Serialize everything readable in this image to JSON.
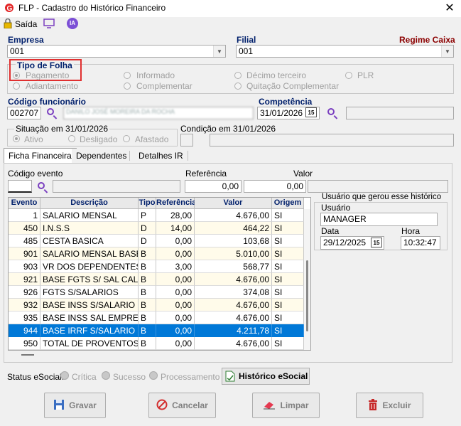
{
  "window": {
    "title": "FLP - Cadastro do Histórico Financeiro",
    "close_label": "✕"
  },
  "toolbar": {
    "saida_label": "Saída",
    "ia_label": "IA"
  },
  "empresa": {
    "label": "Empresa",
    "value": "001"
  },
  "filial": {
    "label": "Filial",
    "value": "001"
  },
  "regime_label": "Regime Caixa",
  "tipo_folha": {
    "label": "Tipo de Folha",
    "options": [
      "Pagamento",
      "Adiantamento",
      "Informado",
      "Complementar",
      "Décimo terceiro",
      "Quitação Complementar",
      "PLR"
    ],
    "selected": "Pagamento"
  },
  "funcionario": {
    "label": "Código funcionário",
    "code": "002707",
    "name": "DANILO JOSÉ MOREIRA DA ROCHA"
  },
  "competencia": {
    "label": "Competência",
    "value": "31/01/2026",
    "cal": "15"
  },
  "situacao": {
    "label": "Situação em  31/01/2026",
    "options": [
      "Ativo",
      "Desligado",
      "Afastado"
    ],
    "selected": "Ativo"
  },
  "condicao_label": "Condição em 31/01/2026",
  "tabs": [
    "Ficha Financeira",
    "Dependentes",
    "Detalhes IR"
  ],
  "evento_form": {
    "codigo_label": "Código evento",
    "referencia_label": "Referência",
    "referencia_value": "0,00",
    "valor_label": "Valor",
    "valor_value": "0,00"
  },
  "grid": {
    "headers": [
      "Evento",
      "Descrição",
      "Tipo",
      "Referência",
      "Valor",
      "Origem"
    ],
    "rows": [
      [
        "1",
        "SALARIO MENSAL",
        "P",
        "28,00",
        "4.676,00",
        "SI"
      ],
      [
        "450",
        "I.N.S.S",
        "D",
        "14,00",
        "464,22",
        "SI"
      ],
      [
        "485",
        "CESTA BASICA",
        "D",
        "0,00",
        "103,68",
        "SI"
      ],
      [
        "901",
        "SALARIO MENSAL BASE",
        "B",
        "0,00",
        "5.010,00",
        "SI"
      ],
      [
        "903",
        "VR DOS DEPENDENTES",
        "B",
        "3,00",
        "568,77",
        "SI"
      ],
      [
        "921",
        "BASE FGTS S/ SAL CALC",
        "B",
        "0,00",
        "4.676,00",
        "SI"
      ],
      [
        "926",
        "FGTS S/SALARIOS",
        "B",
        "0,00",
        "374,08",
        "SI"
      ],
      [
        "932",
        "BASE INSS S/SALARIO",
        "B",
        "0,00",
        "4.676,00",
        "SI"
      ],
      [
        "935",
        "BASE INSS SAL EMPRESA",
        "B",
        "0,00",
        "4.676,00",
        "SI"
      ],
      [
        "944",
        "BASE IRRF S/SALARIO",
        "B",
        "0,00",
        "4.211,78",
        "SI"
      ],
      [
        "950",
        "TOTAL DE PROVENTOS",
        "B",
        "0,00",
        "4.676,00",
        "SI"
      ]
    ],
    "selected_row": 9
  },
  "usuario_box": {
    "title": "Usuário que gerou esse histórico",
    "usuario_label": "Usuário",
    "usuario_value": "MANAGER",
    "data_label": "Data",
    "data_value": "29/12/2025",
    "hora_label": "Hora",
    "hora_value": "10:32:47",
    "cal": "15"
  },
  "esocial": {
    "label": "Status eSocial:",
    "options": [
      "Crítica",
      "Sucesso",
      "Processamento"
    ],
    "historico_button": "Histórico eSocial"
  },
  "buttons": {
    "gravar": "Gravar",
    "cancelar": "Cancelar",
    "limpar": "Limpar",
    "excluir": "Excluir"
  },
  "colors": {
    "accent_blue": "#0078d7",
    "label_blue": "#001f6b",
    "regime_red": "#8b0000",
    "highlight_box": "#e03030"
  }
}
